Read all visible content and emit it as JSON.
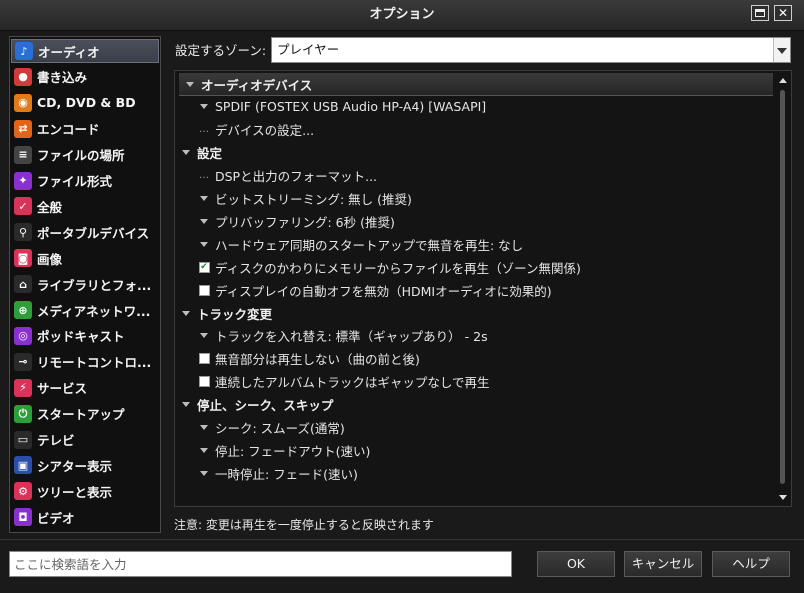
{
  "window": {
    "title": "オプション",
    "close_glyph": "✕"
  },
  "sidebar": {
    "items": [
      {
        "label": "オーディオ",
        "icon": "music-note-icon",
        "glyph": "♪",
        "color": "#2a6fd6",
        "selected": true
      },
      {
        "label": "書き込み",
        "icon": "burn-disc-icon",
        "glyph": "●",
        "color": "#d23b3b"
      },
      {
        "label": "CD, DVD & BD",
        "icon": "disc-icon",
        "glyph": "◉",
        "color": "#e07a1a"
      },
      {
        "label": "エンコード",
        "icon": "encode-icon",
        "glyph": "⇄",
        "color": "#e0651a"
      },
      {
        "label": "ファイルの場所",
        "icon": "file-location-icon",
        "glyph": "≡",
        "color": "#444444"
      },
      {
        "label": "ファイル形式",
        "icon": "puzzle-icon",
        "glyph": "✦",
        "color": "#8a2fd0"
      },
      {
        "label": "全般",
        "icon": "checkbox-icon",
        "glyph": "✓",
        "color": "#d9335a"
      },
      {
        "label": "ポータブルデバイス",
        "icon": "usb-icon",
        "glyph": "⚲",
        "color": "#2a2a2a"
      },
      {
        "label": "画像",
        "icon": "camera-icon",
        "glyph": "◙",
        "color": "#d9335a"
      },
      {
        "label": "ライブラリとフォ...",
        "icon": "home-icon",
        "glyph": "⌂",
        "color": "#2a2a2a"
      },
      {
        "label": "メディアネットワ...",
        "icon": "network-icon",
        "glyph": "⊕",
        "color": "#2e9e3a"
      },
      {
        "label": "ポッドキャスト",
        "icon": "podcast-icon",
        "glyph": "◎",
        "color": "#8a2fd0"
      },
      {
        "label": "リモートコントロ...",
        "icon": "remote-icon",
        "glyph": "⊸",
        "color": "#2a2a2a"
      },
      {
        "label": "サービス",
        "icon": "plug-icon",
        "glyph": "⚡",
        "color": "#d9335a"
      },
      {
        "label": "スタートアップ",
        "icon": "power-icon",
        "glyph": "⏻",
        "color": "#2e9e3a"
      },
      {
        "label": "テレビ",
        "icon": "tv-icon",
        "glyph": "▭",
        "color": "#2a2a2a"
      },
      {
        "label": "シアター表示",
        "icon": "monitor-icon",
        "glyph": "▣",
        "color": "#2a4fa8"
      },
      {
        "label": "ツリーと表示",
        "icon": "gear-icon",
        "glyph": "⚙",
        "color": "#d9335a"
      },
      {
        "label": "ビデオ",
        "icon": "video-camera-icon",
        "glyph": "◘",
        "color": "#8a2fd0"
      }
    ]
  },
  "zone": {
    "label": "設定するゾーン:",
    "value": "プレイヤー"
  },
  "settings": {
    "rows": [
      {
        "type": "section",
        "label": "オーディオデバイス"
      },
      {
        "type": "item",
        "mark": "chevron",
        "label": "SPDIF (FOSTEX USB Audio HP-A4) [WASAPI]"
      },
      {
        "type": "item",
        "mark": "dots",
        "label": "デバイスの設定..."
      },
      {
        "type": "section",
        "label": "設定"
      },
      {
        "type": "item",
        "mark": "dots",
        "label": "DSPと出力のフォーマット..."
      },
      {
        "type": "item",
        "mark": "chevron",
        "label": "ビットストリーミング: 無し (推奨)"
      },
      {
        "type": "item",
        "mark": "chevron",
        "label": "プリバッファリング: 6秒 (推奨)"
      },
      {
        "type": "item",
        "mark": "chevron",
        "label": "ハードウェア同期のスタートアップで無音を再生: なし"
      },
      {
        "type": "item",
        "mark": "checkbox",
        "checked": true,
        "label": "ディスクのかわりにメモリーからファイルを再生（ゾーン無関係)"
      },
      {
        "type": "item",
        "mark": "checkbox",
        "checked": false,
        "label": "ディスプレイの自動オフを無効（HDMIオーディオに効果的)"
      },
      {
        "type": "section",
        "label": "トラック変更"
      },
      {
        "type": "item",
        "mark": "chevron",
        "label": "トラックを入れ替え: 標準（ギャップあり） - 2s"
      },
      {
        "type": "item",
        "mark": "checkbox",
        "checked": false,
        "label": "無音部分は再生しない（曲の前と後)"
      },
      {
        "type": "item",
        "mark": "checkbox",
        "checked": false,
        "label": "連続したアルバムトラックはギャップなしで再生"
      },
      {
        "type": "section",
        "label": "停止、シーク、スキップ"
      },
      {
        "type": "item",
        "mark": "chevron",
        "label": "シーク: スムーズ(通常)"
      },
      {
        "type": "item",
        "mark": "chevron",
        "label": "停止: フェードアウト(速い)"
      },
      {
        "type": "item",
        "mark": "chevron",
        "label": "一時停止: フェード(速い)"
      }
    ]
  },
  "note": "注意: 変更は再生を一度停止すると反映されます",
  "search": {
    "placeholder": "ここに検索語を入力",
    "value": ""
  },
  "buttons": {
    "ok": "OK",
    "cancel": "キャンセル",
    "help": "ヘルプ"
  }
}
